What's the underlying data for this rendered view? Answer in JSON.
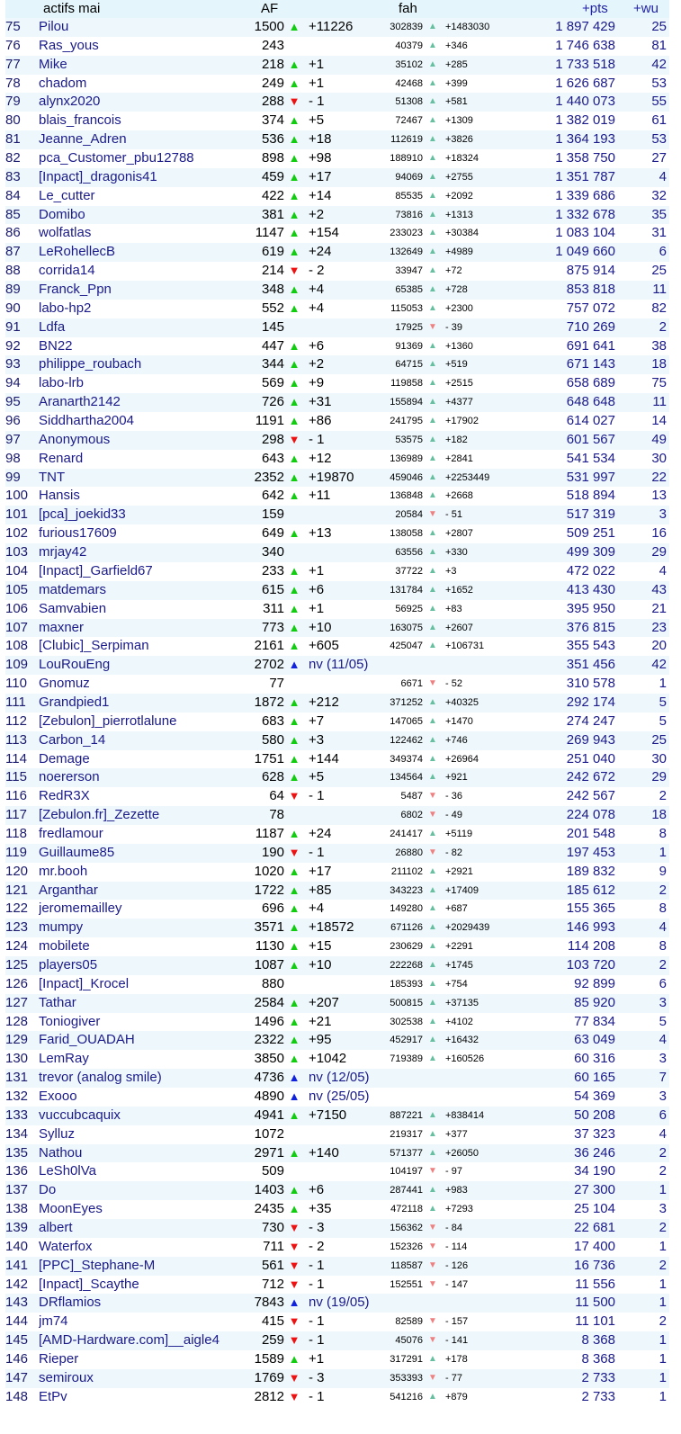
{
  "header": {
    "name": "actifs mai",
    "af": "AF",
    "fah": "fah",
    "pts": "+pts",
    "wu": "+wu"
  },
  "icons": {
    "up_big": "▲",
    "down_big": "▼",
    "new_big": "▲",
    "up_small": "▲",
    "down_small": "▼"
  },
  "colors": {
    "up": "#11cc11",
    "down": "#ee1111",
    "new": "#1122dd",
    "up_small": "#66c0a0",
    "down_small": "#ee8080",
    "row_alt": "#eef8fc",
    "header_bg": "#e4f6fb"
  },
  "rows": [
    {
      "rank": "75",
      "name": "Pilou",
      "af": "1500",
      "af_dir": "up",
      "af_delta": "+11226",
      "fah": "302839",
      "fah_dir": "up",
      "fah_delta": "+1483030",
      "pts": "1 897 429",
      "wu": "25"
    },
    {
      "rank": "76",
      "name": "Ras_yous",
      "af": "243",
      "af_dir": "",
      "af_delta": "",
      "fah": "40379",
      "fah_dir": "up",
      "fah_delta": "+346",
      "pts": "1 746 638",
      "wu": "81"
    },
    {
      "rank": "77",
      "name": "Mike",
      "af": "218",
      "af_dir": "up",
      "af_delta": "+1",
      "fah": "35102",
      "fah_dir": "up",
      "fah_delta": "+285",
      "pts": "1 733 518",
      "wu": "42"
    },
    {
      "rank": "78",
      "name": "chadom",
      "af": "249",
      "af_dir": "up",
      "af_delta": "+1",
      "fah": "42468",
      "fah_dir": "up",
      "fah_delta": "+399",
      "pts": "1 626 687",
      "wu": "53"
    },
    {
      "rank": "79",
      "name": "alynx2020",
      "af": "288",
      "af_dir": "down",
      "af_delta": "- 1",
      "fah": "51308",
      "fah_dir": "up",
      "fah_delta": "+581",
      "pts": "1 440 073",
      "wu": "55"
    },
    {
      "rank": "80",
      "name": "blais_francois",
      "af": "374",
      "af_dir": "up",
      "af_delta": "+5",
      "fah": "72467",
      "fah_dir": "up",
      "fah_delta": "+1309",
      "pts": "1 382 019",
      "wu": "61"
    },
    {
      "rank": "81",
      "name": "Jeanne_Adren",
      "af": "536",
      "af_dir": "up",
      "af_delta": "+18",
      "fah": "112619",
      "fah_dir": "up",
      "fah_delta": "+3826",
      "pts": "1 364 193",
      "wu": "53"
    },
    {
      "rank": "82",
      "name": "pca_Customer_pbu12788",
      "af": "898",
      "af_dir": "up",
      "af_delta": "+98",
      "fah": "188910",
      "fah_dir": "up",
      "fah_delta": "+18324",
      "pts": "1 358 750",
      "wu": "27"
    },
    {
      "rank": "83",
      "name": "[Inpact]_dragonis41",
      "af": "459",
      "af_dir": "up",
      "af_delta": "+17",
      "fah": "94069",
      "fah_dir": "up",
      "fah_delta": "+2755",
      "pts": "1 351 787",
      "wu": "4"
    },
    {
      "rank": "84",
      "name": "Le_cutter",
      "af": "422",
      "af_dir": "up",
      "af_delta": "+14",
      "fah": "85535",
      "fah_dir": "up",
      "fah_delta": "+2092",
      "pts": "1 339 686",
      "wu": "32"
    },
    {
      "rank": "85",
      "name": "Domibo",
      "af": "381",
      "af_dir": "up",
      "af_delta": "+2",
      "fah": "73816",
      "fah_dir": "up",
      "fah_delta": "+1313",
      "pts": "1 332 678",
      "wu": "35"
    },
    {
      "rank": "86",
      "name": "wolfatlas",
      "af": "1147",
      "af_dir": "up",
      "af_delta": "+154",
      "fah": "233023",
      "fah_dir": "up",
      "fah_delta": "+30384",
      "pts": "1 083 104",
      "wu": "31"
    },
    {
      "rank": "87",
      "name": "LeRohellecB",
      "af": "619",
      "af_dir": "up",
      "af_delta": "+24",
      "fah": "132649",
      "fah_dir": "up",
      "fah_delta": "+4989",
      "pts": "1 049 660",
      "wu": "6"
    },
    {
      "rank": "88",
      "name": "corrida14",
      "af": "214",
      "af_dir": "down",
      "af_delta": "- 2",
      "fah": "33947",
      "fah_dir": "up",
      "fah_delta": "+72",
      "pts": "875 914",
      "wu": "25"
    },
    {
      "rank": "89",
      "name": "Franck_Ppn",
      "af": "348",
      "af_dir": "up",
      "af_delta": "+4",
      "fah": "65385",
      "fah_dir": "up",
      "fah_delta": "+728",
      "pts": "853 818",
      "wu": "11"
    },
    {
      "rank": "90",
      "name": "labo-hp2",
      "af": "552",
      "af_dir": "up",
      "af_delta": "+4",
      "fah": "115053",
      "fah_dir": "up",
      "fah_delta": "+2300",
      "pts": "757 072",
      "wu": "82"
    },
    {
      "rank": "91",
      "name": "Ldfa",
      "af": "145",
      "af_dir": "",
      "af_delta": "",
      "fah": "17925",
      "fah_dir": "down",
      "fah_delta": "- 39",
      "pts": "710 269",
      "wu": "2"
    },
    {
      "rank": "92",
      "name": "BN22",
      "af": "447",
      "af_dir": "up",
      "af_delta": "+6",
      "fah": "91369",
      "fah_dir": "up",
      "fah_delta": "+1360",
      "pts": "691 641",
      "wu": "38"
    },
    {
      "rank": "93",
      "name": "philippe_roubach",
      "af": "344",
      "af_dir": "up",
      "af_delta": "+2",
      "fah": "64715",
      "fah_dir": "up",
      "fah_delta": "+519",
      "pts": "671 143",
      "wu": "18"
    },
    {
      "rank": "94",
      "name": "labo-lrb",
      "af": "569",
      "af_dir": "up",
      "af_delta": "+9",
      "fah": "119858",
      "fah_dir": "up",
      "fah_delta": "+2515",
      "pts": "658 689",
      "wu": "75"
    },
    {
      "rank": "95",
      "name": "Aranarth2142",
      "af": "726",
      "af_dir": "up",
      "af_delta": "+31",
      "fah": "155894",
      "fah_dir": "up",
      "fah_delta": "+4377",
      "pts": "648 648",
      "wu": "11"
    },
    {
      "rank": "96",
      "name": "Siddhartha2004",
      "af": "1191",
      "af_dir": "up",
      "af_delta": "+86",
      "fah": "241795",
      "fah_dir": "up",
      "fah_delta": "+17902",
      "pts": "614 027",
      "wu": "14"
    },
    {
      "rank": "97",
      "name": "Anonymous",
      "af": "298",
      "af_dir": "down",
      "af_delta": "- 1",
      "fah": "53575",
      "fah_dir": "up",
      "fah_delta": "+182",
      "pts": "601 567",
      "wu": "49"
    },
    {
      "rank": "98",
      "name": "Renard",
      "af": "643",
      "af_dir": "up",
      "af_delta": "+12",
      "fah": "136989",
      "fah_dir": "up",
      "fah_delta": "+2841",
      "pts": "541 534",
      "wu": "30"
    },
    {
      "rank": "99",
      "name": "TNT",
      "af": "2352",
      "af_dir": "up",
      "af_delta": "+19870",
      "fah": "459046",
      "fah_dir": "up",
      "fah_delta": "+2253449",
      "pts": "531 997",
      "wu": "22"
    },
    {
      "rank": "100",
      "name": "Hansis",
      "af": "642",
      "af_dir": "up",
      "af_delta": "+11",
      "fah": "136848",
      "fah_dir": "up",
      "fah_delta": "+2668",
      "pts": "518 894",
      "wu": "13"
    },
    {
      "rank": "101",
      "name": "[pca]_joekid33",
      "af": "159",
      "af_dir": "",
      "af_delta": "",
      "fah": "20584",
      "fah_dir": "down",
      "fah_delta": "- 51",
      "pts": "517 319",
      "wu": "3"
    },
    {
      "rank": "102",
      "name": "furious17609",
      "af": "649",
      "af_dir": "up",
      "af_delta": "+13",
      "fah": "138058",
      "fah_dir": "up",
      "fah_delta": "+2807",
      "pts": "509 251",
      "wu": "16"
    },
    {
      "rank": "103",
      "name": "mrjay42",
      "af": "340",
      "af_dir": "",
      "af_delta": "",
      "fah": "63556",
      "fah_dir": "up",
      "fah_delta": "+330",
      "pts": "499 309",
      "wu": "29"
    },
    {
      "rank": "104",
      "name": "[Inpact]_Garfield67",
      "af": "233",
      "af_dir": "up",
      "af_delta": "+1",
      "fah": "37722",
      "fah_dir": "up",
      "fah_delta": "+3",
      "pts": "472 022",
      "wu": "4"
    },
    {
      "rank": "105",
      "name": "matdemars",
      "af": "615",
      "af_dir": "up",
      "af_delta": "+6",
      "fah": "131784",
      "fah_dir": "up",
      "fah_delta": "+1652",
      "pts": "413 430",
      "wu": "43"
    },
    {
      "rank": "106",
      "name": "Samvabien",
      "af": "311",
      "af_dir": "up",
      "af_delta": "+1",
      "fah": "56925",
      "fah_dir": "up",
      "fah_delta": "+83",
      "pts": "395 950",
      "wu": "21"
    },
    {
      "rank": "107",
      "name": "maxner",
      "af": "773",
      "af_dir": "up",
      "af_delta": "+10",
      "fah": "163075",
      "fah_dir": "up",
      "fah_delta": "+2607",
      "pts": "376 815",
      "wu": "23"
    },
    {
      "rank": "108",
      "name": "[Clubic]_Serpiman",
      "af": "2161",
      "af_dir": "up",
      "af_delta": "+605",
      "fah": "425047",
      "fah_dir": "up",
      "fah_delta": "+106731",
      "pts": "355 543",
      "wu": "20"
    },
    {
      "rank": "109",
      "name": "LouRouEng",
      "af": "2702",
      "af_dir": "new",
      "af_delta": "nv (11/05)",
      "fah": "",
      "fah_dir": "",
      "fah_delta": "",
      "pts": "351 456",
      "wu": "42"
    },
    {
      "rank": "110",
      "name": "Gnomuz",
      "af": "77",
      "af_dir": "",
      "af_delta": "",
      "fah": "6671",
      "fah_dir": "down",
      "fah_delta": "- 52",
      "pts": "310 578",
      "wu": "1"
    },
    {
      "rank": "111",
      "name": "Grandpied1",
      "af": "1872",
      "af_dir": "up",
      "af_delta": "+212",
      "fah": "371252",
      "fah_dir": "up",
      "fah_delta": "+40325",
      "pts": "292 174",
      "wu": "5"
    },
    {
      "rank": "112",
      "name": "[Zebulon]_pierrotlalune",
      "af": "683",
      "af_dir": "up",
      "af_delta": "+7",
      "fah": "147065",
      "fah_dir": "up",
      "fah_delta": "+1470",
      "pts": "274 247",
      "wu": "5"
    },
    {
      "rank": "113",
      "name": "Carbon_14",
      "af": "580",
      "af_dir": "up",
      "af_delta": "+3",
      "fah": "122462",
      "fah_dir": "up",
      "fah_delta": "+746",
      "pts": "269 943",
      "wu": "25"
    },
    {
      "rank": "114",
      "name": "Demage",
      "af": "1751",
      "af_dir": "up",
      "af_delta": "+144",
      "fah": "349374",
      "fah_dir": "up",
      "fah_delta": "+26964",
      "pts": "251 040",
      "wu": "30"
    },
    {
      "rank": "115",
      "name": "noererson",
      "af": "628",
      "af_dir": "up",
      "af_delta": "+5",
      "fah": "134564",
      "fah_dir": "up",
      "fah_delta": "+921",
      "pts": "242 672",
      "wu": "29"
    },
    {
      "rank": "116",
      "name": "RedR3X",
      "af": "64",
      "af_dir": "down",
      "af_delta": "- 1",
      "fah": "5487",
      "fah_dir": "down",
      "fah_delta": "- 36",
      "pts": "242 567",
      "wu": "2"
    },
    {
      "rank": "117",
      "name": "[Zebulon.fr]_Zezette",
      "af": "78",
      "af_dir": "",
      "af_delta": "",
      "fah": "6802",
      "fah_dir": "down",
      "fah_delta": "- 49",
      "pts": "224 078",
      "wu": "18"
    },
    {
      "rank": "118",
      "name": "fredlamour",
      "af": "1187",
      "af_dir": "up",
      "af_delta": "+24",
      "fah": "241417",
      "fah_dir": "up",
      "fah_delta": "+5119",
      "pts": "201 548",
      "wu": "8"
    },
    {
      "rank": "119",
      "name": "Guillaume85",
      "af": "190",
      "af_dir": "down",
      "af_delta": "- 1",
      "fah": "26880",
      "fah_dir": "down",
      "fah_delta": "- 82",
      "pts": "197 453",
      "wu": "1"
    },
    {
      "rank": "120",
      "name": "mr.booh",
      "af": "1020",
      "af_dir": "up",
      "af_delta": "+17",
      "fah": "211102",
      "fah_dir": "up",
      "fah_delta": "+2921",
      "pts": "189 832",
      "wu": "9"
    },
    {
      "rank": "121",
      "name": "Arganthar",
      "af": "1722",
      "af_dir": "up",
      "af_delta": "+85",
      "fah": "343223",
      "fah_dir": "up",
      "fah_delta": "+17409",
      "pts": "185 612",
      "wu": "2"
    },
    {
      "rank": "122",
      "name": "jeromemailley",
      "af": "696",
      "af_dir": "up",
      "af_delta": "+4",
      "fah": "149280",
      "fah_dir": "up",
      "fah_delta": "+687",
      "pts": "155 365",
      "wu": "8"
    },
    {
      "rank": "123",
      "name": "mumpy",
      "af": "3571",
      "af_dir": "up",
      "af_delta": "+18572",
      "fah": "671126",
      "fah_dir": "up",
      "fah_delta": "+2029439",
      "pts": "146 993",
      "wu": "4"
    },
    {
      "rank": "124",
      "name": "mobilete",
      "af": "1130",
      "af_dir": "up",
      "af_delta": "+15",
      "fah": "230629",
      "fah_dir": "up",
      "fah_delta": "+2291",
      "pts": "114 208",
      "wu": "8"
    },
    {
      "rank": "125",
      "name": "players05",
      "af": "1087",
      "af_dir": "up",
      "af_delta": "+10",
      "fah": "222268",
      "fah_dir": "up",
      "fah_delta": "+1745",
      "pts": "103 720",
      "wu": "2"
    },
    {
      "rank": "126",
      "name": "[Inpact]_Krocel",
      "af": "880",
      "af_dir": "",
      "af_delta": "",
      "fah": "185393",
      "fah_dir": "up",
      "fah_delta": "+754",
      "pts": "92 899",
      "wu": "6"
    },
    {
      "rank": "127",
      "name": "Tathar",
      "af": "2584",
      "af_dir": "up",
      "af_delta": "+207",
      "fah": "500815",
      "fah_dir": "up",
      "fah_delta": "+37135",
      "pts": "85 920",
      "wu": "3"
    },
    {
      "rank": "128",
      "name": "Toniogiver",
      "af": "1496",
      "af_dir": "up",
      "af_delta": "+21",
      "fah": "302538",
      "fah_dir": "up",
      "fah_delta": "+4102",
      "pts": "77 834",
      "wu": "5"
    },
    {
      "rank": "129",
      "name": "Farid_OUADAH",
      "af": "2322",
      "af_dir": "up",
      "af_delta": "+95",
      "fah": "452917",
      "fah_dir": "up",
      "fah_delta": "+16432",
      "pts": "63 049",
      "wu": "4"
    },
    {
      "rank": "130",
      "name": "LemRay",
      "af": "3850",
      "af_dir": "up",
      "af_delta": "+1042",
      "fah": "719389",
      "fah_dir": "up",
      "fah_delta": "+160526",
      "pts": "60 316",
      "wu": "3"
    },
    {
      "rank": "131",
      "name": "trevor (analog smile)",
      "af": "4736",
      "af_dir": "new",
      "af_delta": "nv (12/05)",
      "fah": "",
      "fah_dir": "",
      "fah_delta": "",
      "pts": "60 165",
      "wu": "7"
    },
    {
      "rank": "132",
      "name": "Exooo",
      "af": "4890",
      "af_dir": "new",
      "af_delta": "nv (25/05)",
      "fah": "",
      "fah_dir": "",
      "fah_delta": "",
      "pts": "54 369",
      "wu": "3"
    },
    {
      "rank": "133",
      "name": "vuccubcaquix",
      "af": "4941",
      "af_dir": "up",
      "af_delta": "+7150",
      "fah": "887221",
      "fah_dir": "up",
      "fah_delta": "+838414",
      "pts": "50 208",
      "wu": "6"
    },
    {
      "rank": "134",
      "name": "Sylluz",
      "af": "1072",
      "af_dir": "",
      "af_delta": "",
      "fah": "219317",
      "fah_dir": "up",
      "fah_delta": "+377",
      "pts": "37 323",
      "wu": "4"
    },
    {
      "rank": "135",
      "name": "Nathou",
      "af": "2971",
      "af_dir": "up",
      "af_delta": "+140",
      "fah": "571377",
      "fah_dir": "up",
      "fah_delta": "+26050",
      "pts": "36 246",
      "wu": "2"
    },
    {
      "rank": "136",
      "name": "LeSh0lVa",
      "af": "509",
      "af_dir": "",
      "af_delta": "",
      "fah": "104197",
      "fah_dir": "down",
      "fah_delta": "- 97",
      "pts": "34 190",
      "wu": "2"
    },
    {
      "rank": "137",
      "name": "Do",
      "af": "1403",
      "af_dir": "up",
      "af_delta": "+6",
      "fah": "287441",
      "fah_dir": "up",
      "fah_delta": "+983",
      "pts": "27 300",
      "wu": "1"
    },
    {
      "rank": "138",
      "name": "MoonEyes",
      "af": "2435",
      "af_dir": "up",
      "af_delta": "+35",
      "fah": "472118",
      "fah_dir": "up",
      "fah_delta": "+7293",
      "pts": "25 104",
      "wu": "3"
    },
    {
      "rank": "139",
      "name": "albert",
      "af": "730",
      "af_dir": "down",
      "af_delta": "- 3",
      "fah": "156362",
      "fah_dir": "down",
      "fah_delta": "- 84",
      "pts": "22 681",
      "wu": "2"
    },
    {
      "rank": "140",
      "name": "Waterfox",
      "af": "711",
      "af_dir": "down",
      "af_delta": "- 2",
      "fah": "152326",
      "fah_dir": "down",
      "fah_delta": "- 114",
      "pts": "17 400",
      "wu": "1"
    },
    {
      "rank": "141",
      "name": "[PPC]_Stephane-M",
      "af": "561",
      "af_dir": "down",
      "af_delta": "- 1",
      "fah": "118587",
      "fah_dir": "down",
      "fah_delta": "- 126",
      "pts": "16 736",
      "wu": "2"
    },
    {
      "rank": "142",
      "name": "[Inpact]_Scaythe",
      "af": "712",
      "af_dir": "down",
      "af_delta": "- 1",
      "fah": "152551",
      "fah_dir": "down",
      "fah_delta": "- 147",
      "pts": "11 556",
      "wu": "1"
    },
    {
      "rank": "143",
      "name": "DRflamios",
      "af": "7843",
      "af_dir": "new",
      "af_delta": "nv (19/05)",
      "fah": "",
      "fah_dir": "",
      "fah_delta": "",
      "pts": "11 500",
      "wu": "1"
    },
    {
      "rank": "144",
      "name": "jm74",
      "af": "415",
      "af_dir": "down",
      "af_delta": "- 1",
      "fah": "82589",
      "fah_dir": "down",
      "fah_delta": "- 157",
      "pts": "11 101",
      "wu": "2"
    },
    {
      "rank": "145",
      "name": "[AMD-Hardware.com]__aigle4",
      "af": "259",
      "af_dir": "down",
      "af_delta": "- 1",
      "fah": "45076",
      "fah_dir": "down",
      "fah_delta": "- 141",
      "pts": "8 368",
      "wu": "1"
    },
    {
      "rank": "146",
      "name": "Rieper",
      "af": "1589",
      "af_dir": "up",
      "af_delta": "+1",
      "fah": "317291",
      "fah_dir": "up",
      "fah_delta": "+178",
      "pts": "8 368",
      "wu": "1"
    },
    {
      "rank": "147",
      "name": "semiroux",
      "af": "1769",
      "af_dir": "down",
      "af_delta": "- 3",
      "fah": "353393",
      "fah_dir": "down",
      "fah_delta": "- 77",
      "pts": "2 733",
      "wu": "1"
    },
    {
      "rank": "148",
      "name": "EtPv",
      "af": "2812",
      "af_dir": "down",
      "af_delta": "- 1",
      "fah": "541216",
      "fah_dir": "up",
      "fah_delta": "+879",
      "pts": "2 733",
      "wu": "1"
    }
  ]
}
